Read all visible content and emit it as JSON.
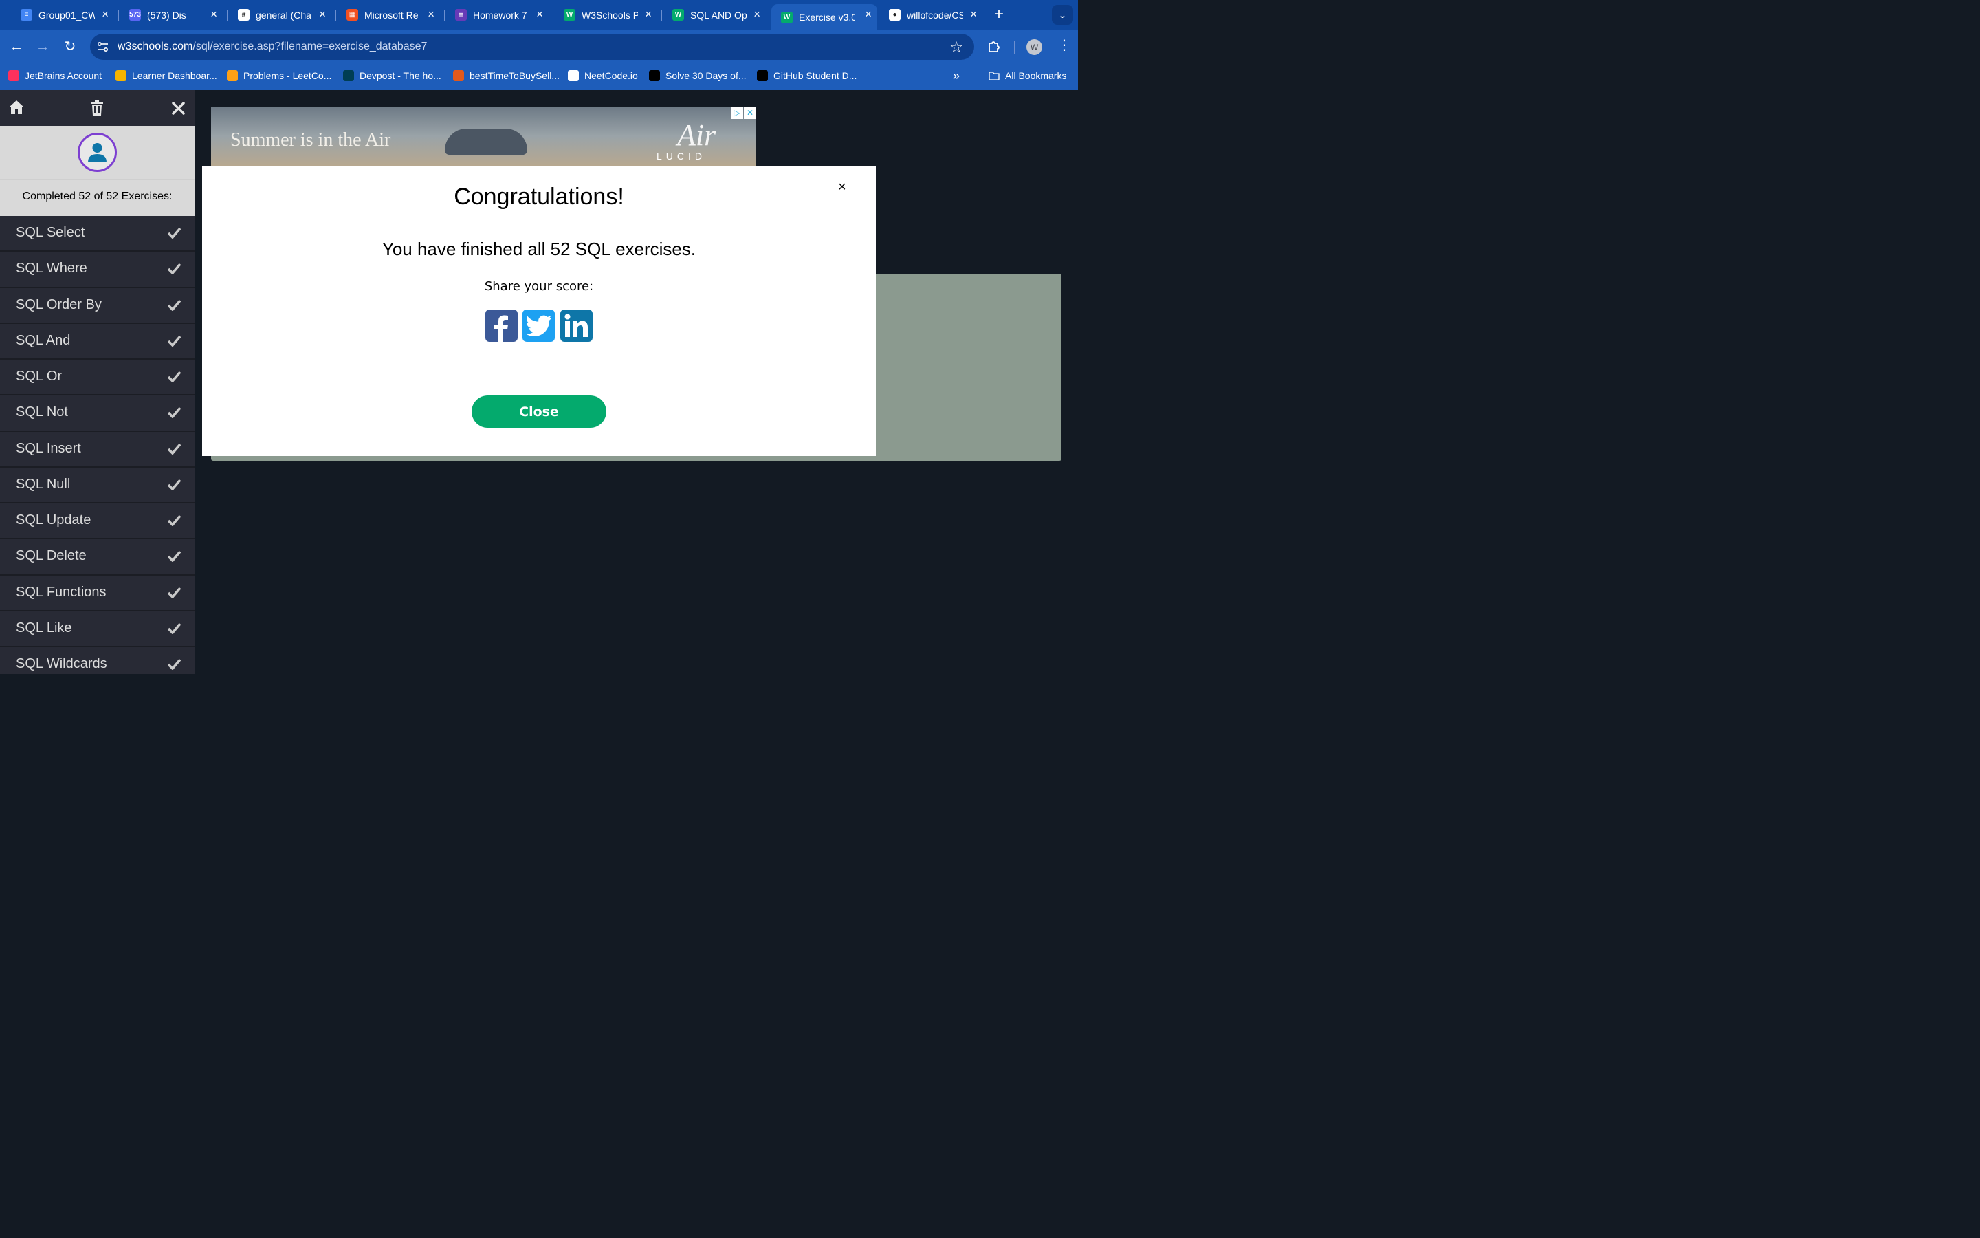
{
  "browser": {
    "tabs": [
      {
        "title": "Group01_CW",
        "fav_color": "#4285f4",
        "fav_glyph": "≡"
      },
      {
        "title": "(573) Dis",
        "fav_color": "#5865f2",
        "fav_glyph": "573"
      },
      {
        "title": "general (Cha",
        "fav_color": "#ffffff",
        "fav_glyph": "#"
      },
      {
        "title": "Microsoft Re",
        "fav_color": "#f25022",
        "fav_glyph": "▦"
      },
      {
        "title": "Homework 7",
        "fav_color": "#673ab7",
        "fav_glyph": "≣"
      },
      {
        "title": "W3Schools P",
        "fav_color": "#04aa6d",
        "fav_glyph": "W"
      },
      {
        "title": "SQL AND Op",
        "fav_color": "#04aa6d",
        "fav_glyph": "W"
      },
      {
        "title": "Exercise v3.0",
        "fav_color": "#04aa6d",
        "fav_glyph": "W"
      },
      {
        "title": "willofcode/CS",
        "fav_color": "#ffffff",
        "fav_glyph": "●"
      }
    ],
    "url_host": "w3schools.com",
    "url_path": "/sql/exercise.asp?filename=exercise_database7",
    "profile_initial": "W",
    "bookmarks": [
      {
        "label": "JetBrains Account",
        "color": "#fe315d"
      },
      {
        "label": "Learner Dashboar...",
        "color": "#f5b400"
      },
      {
        "label": "Problems - LeetCo...",
        "color": "#ffa116"
      },
      {
        "label": "Devpost - The ho...",
        "color": "#003e54"
      },
      {
        "label": "bestTimeToBuySell...",
        "color": "#e2591c"
      },
      {
        "label": "NeetCode.io",
        "color": "#ffffff"
      },
      {
        "label": "Solve 30 Days of...",
        "color": "#000000"
      },
      {
        "label": "GitHub Student D...",
        "color": "#000000"
      }
    ],
    "all_bookmarks": "All Bookmarks"
  },
  "sidebar": {
    "progress": "Completed 52 of 52 Exercises:",
    "items": [
      "SQL Select",
      "SQL Where",
      "SQL Order By",
      "SQL And",
      "SQL Or",
      "SQL Not",
      "SQL Insert",
      "SQL Null",
      "SQL Update",
      "SQL Delete",
      "SQL Functions",
      "SQL Like",
      "SQL Wildcards"
    ]
  },
  "ad": {
    "slogan": "Summer is in the Air",
    "brand": "LUCID",
    "script": "Air"
  },
  "modal": {
    "title": "Congratulations!",
    "message": "You have finished all 52 SQL exercises.",
    "share_label": "Share your score:",
    "close_label": "Close",
    "x_label": "×"
  },
  "colors": {
    "accent": "#04aa6d",
    "facebook": "#3b5998",
    "twitter": "#1da1f2",
    "linkedin": "#0e76a8"
  }
}
